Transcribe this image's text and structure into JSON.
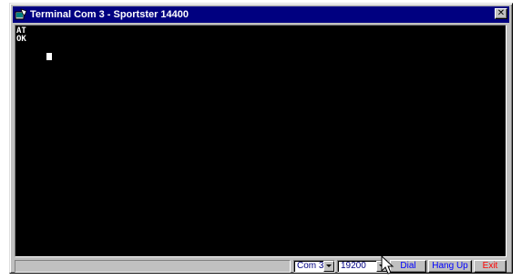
{
  "window": {
    "title": "Terminal Com 3 - Sportster 14400",
    "close_glyph": "✕"
  },
  "terminal": {
    "lines": [
      "AT",
      "OK"
    ],
    "text_color": "#ffffff",
    "background": "#000000"
  },
  "statusbar": {
    "status_text": "",
    "port_select": {
      "value": "Com 3"
    },
    "baud_select": {
      "value": "19200"
    },
    "buttons": {
      "dial": "Dial",
      "hangup": "Hang Up",
      "exit": "Exit"
    }
  },
  "colors": {
    "titlebar": "#000080",
    "button_text_blue": "#0000ff",
    "exit_text_red": "#ff0000"
  },
  "icons": {
    "title_icon": "terminal-app-icon",
    "pointer": "mouse-pointer-icon"
  }
}
